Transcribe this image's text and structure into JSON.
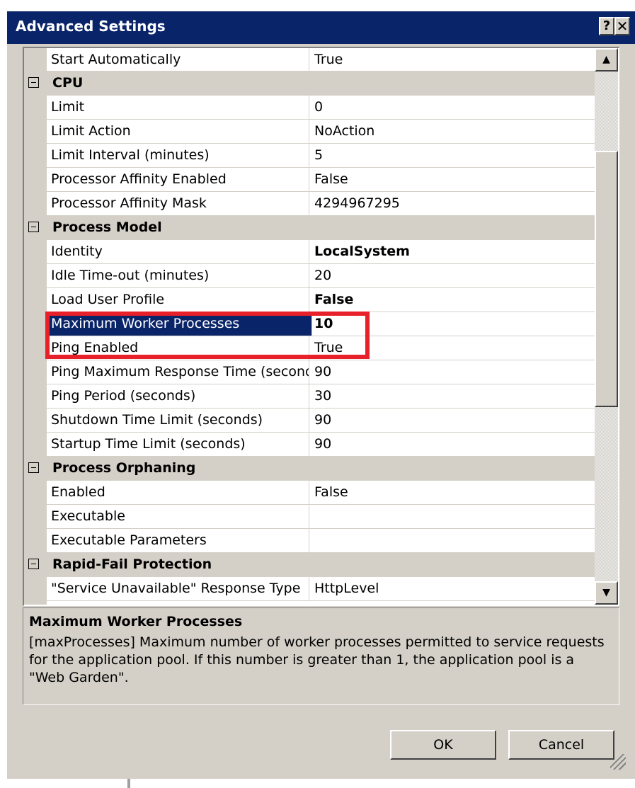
{
  "window": {
    "title": "Advanced Settings",
    "help_glyph": "?",
    "close_glyph": "✕"
  },
  "grid": {
    "rows": [
      {
        "kind": "prop",
        "name": "Start Automatically",
        "value": "True"
      },
      {
        "kind": "cat",
        "name": "CPU"
      },
      {
        "kind": "prop",
        "name": "Limit",
        "value": "0"
      },
      {
        "kind": "prop",
        "name": "Limit Action",
        "value": "NoAction"
      },
      {
        "kind": "prop",
        "name": "Limit Interval (minutes)",
        "value": "5"
      },
      {
        "kind": "prop",
        "name": "Processor Affinity Enabled",
        "value": "False"
      },
      {
        "kind": "prop",
        "name": "Processor Affinity Mask",
        "value": "4294967295"
      },
      {
        "kind": "cat",
        "name": "Process Model"
      },
      {
        "kind": "prop",
        "name": "Identity",
        "value": "LocalSystem",
        "bold": true
      },
      {
        "kind": "prop",
        "name": "Idle Time-out (minutes)",
        "value": "20"
      },
      {
        "kind": "prop",
        "name": "Load User Profile",
        "value": "False",
        "bold": true
      },
      {
        "kind": "prop",
        "name": "Maximum Worker Processes",
        "value": "10",
        "bold": true,
        "selected": true
      },
      {
        "kind": "prop",
        "name": "Ping Enabled",
        "value": "True"
      },
      {
        "kind": "prop",
        "name": "Ping Maximum Response Time (seconds)",
        "value": "90"
      },
      {
        "kind": "prop",
        "name": "Ping Period (seconds)",
        "value": "30"
      },
      {
        "kind": "prop",
        "name": "Shutdown Time Limit (seconds)",
        "value": "90"
      },
      {
        "kind": "prop",
        "name": "Startup Time Limit (seconds)",
        "value": "90"
      },
      {
        "kind": "cat",
        "name": "Process Orphaning"
      },
      {
        "kind": "prop",
        "name": "Enabled",
        "value": "False"
      },
      {
        "kind": "prop",
        "name": "Executable",
        "value": ""
      },
      {
        "kind": "prop",
        "name": "Executable Parameters",
        "value": ""
      },
      {
        "kind": "cat",
        "name": "Rapid-Fail Protection"
      },
      {
        "kind": "prop",
        "name": "\"Service Unavailable\" Response Type",
        "value": "HttpLevel"
      }
    ]
  },
  "description": {
    "title": "Maximum Worker Processes",
    "body": "[maxProcesses] Maximum number of worker processes permitted to service requests for the application pool. If this number is greater than 1, the application pool is a \"Web Garden\"."
  },
  "buttons": {
    "ok": "OK",
    "cancel": "Cancel"
  },
  "icons": {
    "expander": "collapse-icon",
    "scroll_up": "up-arrow-icon",
    "scroll_down": "down-arrow-icon"
  },
  "colors": {
    "highlight": "#e8202a",
    "titlebar": "#0a246a",
    "selection": "#0a246a"
  }
}
